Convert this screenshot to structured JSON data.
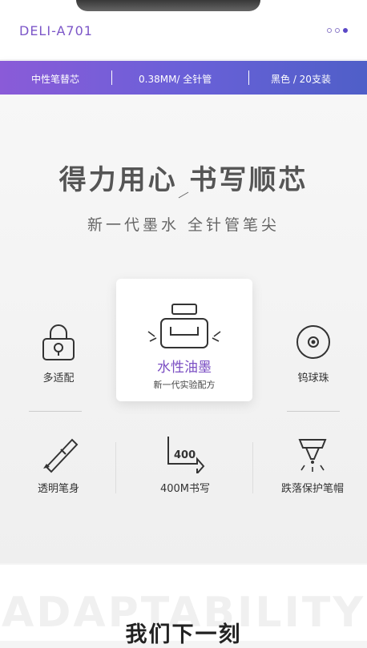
{
  "header": {
    "brand": "DELI-A701",
    "carousel_dots": 3,
    "active_dot": 3
  },
  "specs": [
    "中性笔替芯",
    "0.38MM/ 全针管",
    "黑色 / 20支装"
  ],
  "hero": {
    "headline": "得力用心 书写顺芯",
    "subline": "新一代墨水  全针管笔尖"
  },
  "features": {
    "adaptable": "多适配",
    "ink_title": "水性油墨",
    "ink_subtitle": "新一代实验配方",
    "tip": "钨球珠",
    "body": "透明笔身",
    "length": "400M书写",
    "length_badge": "400",
    "cap": "跌落保护笔帽"
  },
  "lower": {
    "watermark": "ADAPTABILITY",
    "title": "我们下一刻"
  },
  "colors": {
    "accent": "#7b4fc3",
    "band_start": "#8a5bd8",
    "band_end": "#4f5fc8"
  },
  "icons": [
    "lock-icon",
    "ink-bottle-icon",
    "ballpoint-icon",
    "pen-icon",
    "400m-arrow-icon",
    "pen-tip-icon"
  ]
}
